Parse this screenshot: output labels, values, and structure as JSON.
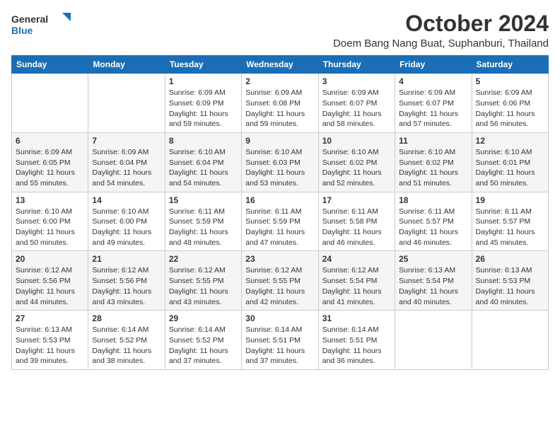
{
  "logo": {
    "line1": "General",
    "line2": "Blue"
  },
  "title": "October 2024",
  "subtitle": "Doem Bang Nang Buat, Suphanburi, Thailand",
  "weekdays": [
    "Sunday",
    "Monday",
    "Tuesday",
    "Wednesday",
    "Thursday",
    "Friday",
    "Saturday"
  ],
  "weeks": [
    [
      {
        "day": "",
        "info": ""
      },
      {
        "day": "",
        "info": ""
      },
      {
        "day": "1",
        "sunrise": "Sunrise: 6:09 AM",
        "sunset": "Sunset: 6:09 PM",
        "daylight": "Daylight: 11 hours and 59 minutes."
      },
      {
        "day": "2",
        "sunrise": "Sunrise: 6:09 AM",
        "sunset": "Sunset: 6:08 PM",
        "daylight": "Daylight: 11 hours and 59 minutes."
      },
      {
        "day": "3",
        "sunrise": "Sunrise: 6:09 AM",
        "sunset": "Sunset: 6:07 PM",
        "daylight": "Daylight: 11 hours and 58 minutes."
      },
      {
        "day": "4",
        "sunrise": "Sunrise: 6:09 AM",
        "sunset": "Sunset: 6:07 PM",
        "daylight": "Daylight: 11 hours and 57 minutes."
      },
      {
        "day": "5",
        "sunrise": "Sunrise: 6:09 AM",
        "sunset": "Sunset: 6:06 PM",
        "daylight": "Daylight: 11 hours and 56 minutes."
      }
    ],
    [
      {
        "day": "6",
        "sunrise": "Sunrise: 6:09 AM",
        "sunset": "Sunset: 6:05 PM",
        "daylight": "Daylight: 11 hours and 55 minutes."
      },
      {
        "day": "7",
        "sunrise": "Sunrise: 6:09 AM",
        "sunset": "Sunset: 6:04 PM",
        "daylight": "Daylight: 11 hours and 54 minutes."
      },
      {
        "day": "8",
        "sunrise": "Sunrise: 6:10 AM",
        "sunset": "Sunset: 6:04 PM",
        "daylight": "Daylight: 11 hours and 54 minutes."
      },
      {
        "day": "9",
        "sunrise": "Sunrise: 6:10 AM",
        "sunset": "Sunset: 6:03 PM",
        "daylight": "Daylight: 11 hours and 53 minutes."
      },
      {
        "day": "10",
        "sunrise": "Sunrise: 6:10 AM",
        "sunset": "Sunset: 6:02 PM",
        "daylight": "Daylight: 11 hours and 52 minutes."
      },
      {
        "day": "11",
        "sunrise": "Sunrise: 6:10 AM",
        "sunset": "Sunset: 6:02 PM",
        "daylight": "Daylight: 11 hours and 51 minutes."
      },
      {
        "day": "12",
        "sunrise": "Sunrise: 6:10 AM",
        "sunset": "Sunset: 6:01 PM",
        "daylight": "Daylight: 11 hours and 50 minutes."
      }
    ],
    [
      {
        "day": "13",
        "sunrise": "Sunrise: 6:10 AM",
        "sunset": "Sunset: 6:00 PM",
        "daylight": "Daylight: 11 hours and 50 minutes."
      },
      {
        "day": "14",
        "sunrise": "Sunrise: 6:10 AM",
        "sunset": "Sunset: 6:00 PM",
        "daylight": "Daylight: 11 hours and 49 minutes."
      },
      {
        "day": "15",
        "sunrise": "Sunrise: 6:11 AM",
        "sunset": "Sunset: 5:59 PM",
        "daylight": "Daylight: 11 hours and 48 minutes."
      },
      {
        "day": "16",
        "sunrise": "Sunrise: 6:11 AM",
        "sunset": "Sunset: 5:59 PM",
        "daylight": "Daylight: 11 hours and 47 minutes."
      },
      {
        "day": "17",
        "sunrise": "Sunrise: 6:11 AM",
        "sunset": "Sunset: 5:58 PM",
        "daylight": "Daylight: 11 hours and 46 minutes."
      },
      {
        "day": "18",
        "sunrise": "Sunrise: 6:11 AM",
        "sunset": "Sunset: 5:57 PM",
        "daylight": "Daylight: 11 hours and 46 minutes."
      },
      {
        "day": "19",
        "sunrise": "Sunrise: 6:11 AM",
        "sunset": "Sunset: 5:57 PM",
        "daylight": "Daylight: 11 hours and 45 minutes."
      }
    ],
    [
      {
        "day": "20",
        "sunrise": "Sunrise: 6:12 AM",
        "sunset": "Sunset: 5:56 PM",
        "daylight": "Daylight: 11 hours and 44 minutes."
      },
      {
        "day": "21",
        "sunrise": "Sunrise: 6:12 AM",
        "sunset": "Sunset: 5:56 PM",
        "daylight": "Daylight: 11 hours and 43 minutes."
      },
      {
        "day": "22",
        "sunrise": "Sunrise: 6:12 AM",
        "sunset": "Sunset: 5:55 PM",
        "daylight": "Daylight: 11 hours and 43 minutes."
      },
      {
        "day": "23",
        "sunrise": "Sunrise: 6:12 AM",
        "sunset": "Sunset: 5:55 PM",
        "daylight": "Daylight: 11 hours and 42 minutes."
      },
      {
        "day": "24",
        "sunrise": "Sunrise: 6:12 AM",
        "sunset": "Sunset: 5:54 PM",
        "daylight": "Daylight: 11 hours and 41 minutes."
      },
      {
        "day": "25",
        "sunrise": "Sunrise: 6:13 AM",
        "sunset": "Sunset: 5:54 PM",
        "daylight": "Daylight: 11 hours and 40 minutes."
      },
      {
        "day": "26",
        "sunrise": "Sunrise: 6:13 AM",
        "sunset": "Sunset: 5:53 PM",
        "daylight": "Daylight: 11 hours and 40 minutes."
      }
    ],
    [
      {
        "day": "27",
        "sunrise": "Sunrise: 6:13 AM",
        "sunset": "Sunset: 5:53 PM",
        "daylight": "Daylight: 11 hours and 39 minutes."
      },
      {
        "day": "28",
        "sunrise": "Sunrise: 6:14 AM",
        "sunset": "Sunset: 5:52 PM",
        "daylight": "Daylight: 11 hours and 38 minutes."
      },
      {
        "day": "29",
        "sunrise": "Sunrise: 6:14 AM",
        "sunset": "Sunset: 5:52 PM",
        "daylight": "Daylight: 11 hours and 37 minutes."
      },
      {
        "day": "30",
        "sunrise": "Sunrise: 6:14 AM",
        "sunset": "Sunset: 5:51 PM",
        "daylight": "Daylight: 11 hours and 37 minutes."
      },
      {
        "day": "31",
        "sunrise": "Sunrise: 6:14 AM",
        "sunset": "Sunset: 5:51 PM",
        "daylight": "Daylight: 11 hours and 36 minutes."
      },
      {
        "day": "",
        "info": ""
      },
      {
        "day": "",
        "info": ""
      }
    ]
  ]
}
